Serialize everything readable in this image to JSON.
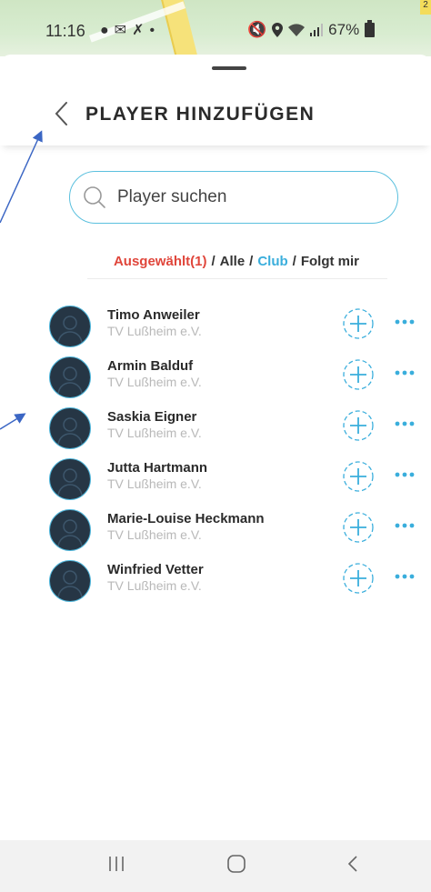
{
  "status_bar": {
    "time": "11:16",
    "left_icons": [
      "bulb-icon",
      "mail-icon",
      "missed-call-icon",
      "dot-icon"
    ],
    "right_icons": [
      "mute-icon",
      "location-icon",
      "wifi-icon",
      "signal-icon"
    ],
    "battery": "67%",
    "badge": "2"
  },
  "header": {
    "title": "PLAYER HINZUFÜGEN"
  },
  "search": {
    "placeholder": "Player suchen",
    "value": ""
  },
  "filters": {
    "selected": "Ausgewählt(1)",
    "sep1": "/",
    "all": "Alle",
    "sep2": "/",
    "club": "Club",
    "sep3": "/",
    "followers": "Folgt mir",
    "colors": {
      "selected": "#e0463b",
      "club": "#3aaedc"
    }
  },
  "players": [
    {
      "name": "Timo Anweiler",
      "club": "TV Lußheim e.V."
    },
    {
      "name": "Armin Balduf",
      "club": "TV Lußheim e.V."
    },
    {
      "name": "Saskia Eigner",
      "club": "TV Lußheim e.V."
    },
    {
      "name": "Jutta Hartmann",
      "club": "TV Lußheim e.V."
    },
    {
      "name": "Marie-Louise Heckmann",
      "club": "TV Lußheim e.V."
    },
    {
      "name": "Winfried Vetter",
      "club": "TV Lußheim e.V."
    }
  ],
  "navbar": {
    "items": [
      "recent-apps-icon",
      "home-icon",
      "back-icon"
    ]
  },
  "accent_color": "#3aaedc"
}
